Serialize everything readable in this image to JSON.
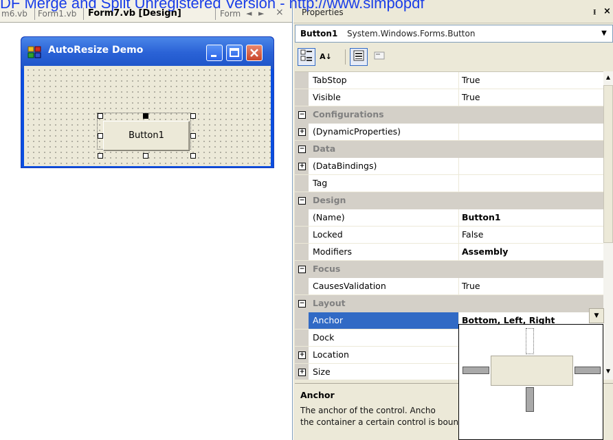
{
  "watermark": "DF Merge and Split Unregistered Version - http://www.simpopdf",
  "doc_tabs": {
    "items": [
      "m6.vb",
      "Form1.vb",
      "Form7.vb [Design]",
      "Form"
    ],
    "active_index": 2,
    "scroll_left": "◄",
    "scroll_right": "►",
    "close": "×"
  },
  "form": {
    "title": "AutoResize  Demo",
    "button_label": "Button1"
  },
  "properties": {
    "title": "Properties",
    "pin": "ᵻ",
    "close": "×",
    "object": {
      "name": "Button1",
      "type": "System.Windows.Forms.Button",
      "arrow": "▼"
    },
    "toolbar": {
      "categorized": "▦",
      "alphabetical": "A↓",
      "properties": "▤",
      "events": "▭"
    },
    "rows": [
      {
        "kind": "prop",
        "name": "TabStop",
        "value": "True"
      },
      {
        "kind": "prop",
        "name": "Visible",
        "value": "True"
      },
      {
        "kind": "cat",
        "name": "Configurations",
        "expander": "−"
      },
      {
        "kind": "prop",
        "name": "(DynamicProperties)",
        "value": "",
        "expander": "+"
      },
      {
        "kind": "cat",
        "name": "Data",
        "expander": "−"
      },
      {
        "kind": "prop",
        "name": "(DataBindings)",
        "value": "",
        "expander": "+"
      },
      {
        "kind": "prop",
        "name": "Tag",
        "value": ""
      },
      {
        "kind": "cat",
        "name": "Design",
        "expander": "−"
      },
      {
        "kind": "prop",
        "name": "(Name)",
        "value": "Button1",
        "bold": true
      },
      {
        "kind": "prop",
        "name": "Locked",
        "value": "False"
      },
      {
        "kind": "prop",
        "name": "Modifiers",
        "value": "Assembly",
        "bold": true
      },
      {
        "kind": "cat",
        "name": "Focus",
        "expander": "−"
      },
      {
        "kind": "prop",
        "name": "CausesValidation",
        "value": "True"
      },
      {
        "kind": "cat",
        "name": "Layout",
        "expander": "−"
      },
      {
        "kind": "prop",
        "name": "Anchor",
        "value": "Bottom, Left, Right",
        "bold": true,
        "selected": true
      },
      {
        "kind": "prop",
        "name": "Dock",
        "value": ""
      },
      {
        "kind": "prop",
        "name": "Location",
        "value": "",
        "expander": "+"
      },
      {
        "kind": "prop",
        "name": "Size",
        "value": "",
        "expander": "+"
      }
    ],
    "dropdown_arrow": "▼",
    "scroll_up": "▲",
    "scroll_down": "▼",
    "anchor_editor": {
      "top": false,
      "left": true,
      "right": true,
      "bottom": true
    },
    "description": {
      "title": "Anchor",
      "line1": "The anchor of the control. Ancho",
      "line2": "the container a certain control is bound. When a control is  ..."
    }
  },
  "colors": {
    "selection": "#316ac5",
    "xp_title_blue": "#2a62d6",
    "close_red": "#c9462a",
    "panel_bg": "#ece9d8"
  }
}
